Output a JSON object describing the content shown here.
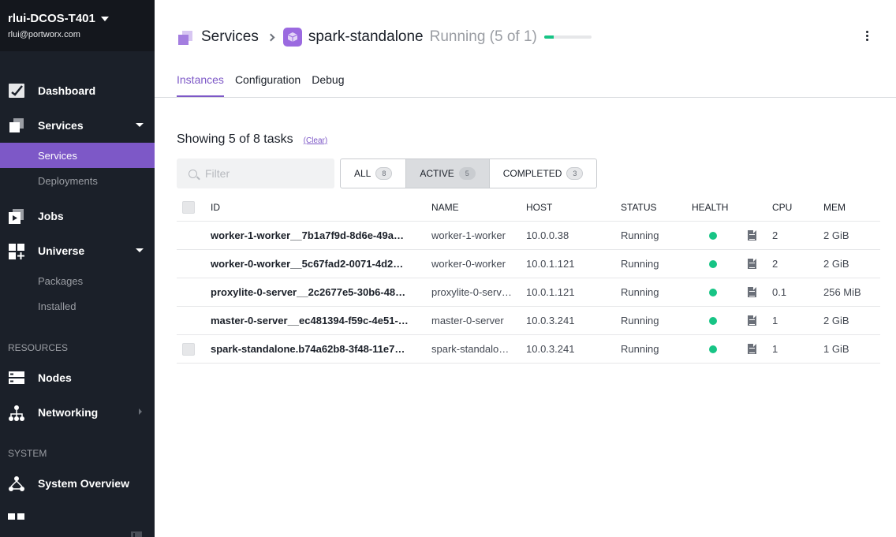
{
  "sidebar": {
    "cluster_name": "rlui-DCOS-T401",
    "user_email": "rlui@portworx.com",
    "items": {
      "dashboard": "Dashboard",
      "services": "Services",
      "services_sub": "Services",
      "deployments": "Deployments",
      "jobs": "Jobs",
      "universe": "Universe",
      "packages": "Packages",
      "installed": "Installed",
      "resources_section": "RESOURCES",
      "nodes": "Nodes",
      "networking": "Networking",
      "system_section": "SYSTEM",
      "system_overview": "System Overview"
    },
    "accent_color": "#7d58c7"
  },
  "header": {
    "breadcrumb_root": "Services",
    "service_name": "spark-standalone",
    "status": "Running (5 of 1)",
    "progress": 0.2
  },
  "tabs": [
    "Instances",
    "Configuration",
    "Debug"
  ],
  "tasks": {
    "showing_text": "Showing 5 of 8 tasks",
    "clear_label": "(Clear)",
    "filter_placeholder": "Filter",
    "filters": [
      {
        "label": "ALL",
        "count": "8"
      },
      {
        "label": "ACTIVE",
        "count": "5"
      },
      {
        "label": "COMPLETED",
        "count": "3"
      }
    ],
    "columns": [
      "ID",
      "NAME",
      "HOST",
      "STATUS",
      "HEALTH",
      "CPU",
      "MEM"
    ],
    "rows": [
      {
        "id": "worker-1-worker__7b1a7f9d-8d6e-49a…",
        "name": "worker-1-worker",
        "host": "10.0.0.38",
        "status": "Running",
        "cpu": "2",
        "mem": "2 GiB"
      },
      {
        "id": "worker-0-worker__5c67fad2-0071-4d2…",
        "name": "worker-0-worker",
        "host": "10.0.1.121",
        "status": "Running",
        "cpu": "2",
        "mem": "2 GiB"
      },
      {
        "id": "proxylite-0-server__2c2677e5-30b6-48…",
        "name": "proxylite-0-serv…",
        "host": "10.0.1.121",
        "status": "Running",
        "cpu": "0.1",
        "mem": "256 MiB"
      },
      {
        "id": "master-0-server__ec481394-f59c-4e51-…",
        "name": "master-0-server",
        "host": "10.0.3.241",
        "status": "Running",
        "cpu": "1",
        "mem": "2 GiB"
      },
      {
        "id": "spark-standalone.b74a62b8-3f48-11e7…",
        "name": "spark-standalo…",
        "host": "10.0.3.241",
        "status": "Running",
        "cpu": "1",
        "mem": "1 GiB"
      }
    ],
    "health_color": "#17c485"
  }
}
